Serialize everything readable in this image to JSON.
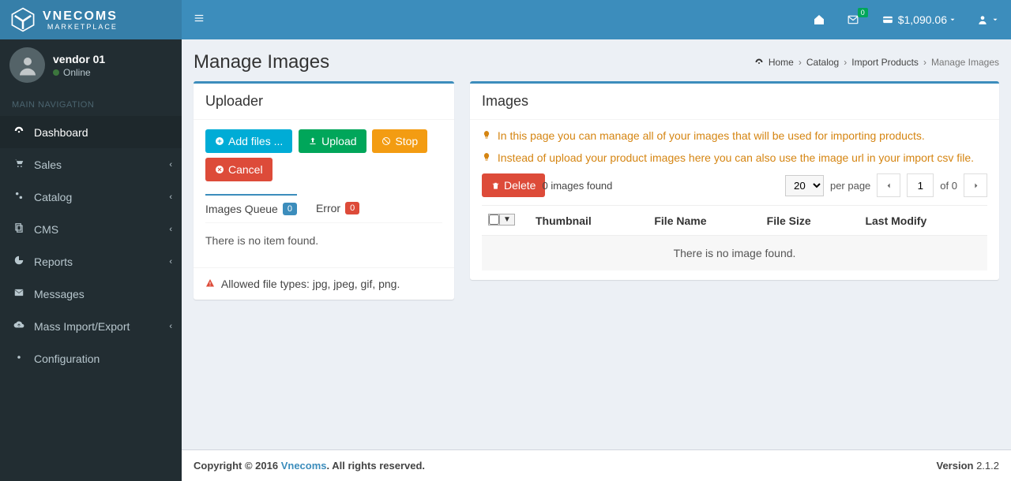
{
  "brand": {
    "name": "VNECOMS",
    "sub": "MARKETPLACE"
  },
  "user": {
    "name": "vendor 01",
    "status": "Online"
  },
  "nav_header": "MAIN NAVIGATION",
  "nav": {
    "dashboard": "Dashboard",
    "sales": "Sales",
    "catalog": "Catalog",
    "cms": "CMS",
    "reports": "Reports",
    "messages": "Messages",
    "massio": "Mass Import/Export",
    "config": "Configuration"
  },
  "topbar": {
    "mail_badge": "0",
    "balance": "$1,090.06"
  },
  "breadcrumb": {
    "home": "Home",
    "catalog": "Catalog",
    "import": "Import Products",
    "current": "Manage Images"
  },
  "page_title": "Manage Images",
  "uploader": {
    "title": "Uploader",
    "add": "Add files ...",
    "upload": "Upload",
    "stop": "Stop",
    "cancel": "Cancel",
    "tab_queue": "Images Queue",
    "tab_queue_count": "0",
    "tab_error": "Error",
    "tab_error_count": "0",
    "empty": "There is no item found.",
    "allowed": "Allowed file types: jpg, jpeg, gif, png."
  },
  "images": {
    "title": "Images",
    "tip1": "In this page you can manage all of your images that will be used for importing products.",
    "tip2": "Instead of upload your product images here you can also use the image url in your import csv file.",
    "delete": "Delete",
    "found_count": "0",
    "found_label": "images found",
    "perpage_value": "20",
    "perpage_label": "per page",
    "page_current": "1",
    "page_total": "0",
    "page_of": "of",
    "th_thumb": "Thumbnail",
    "th_file": "File Name",
    "th_size": "File Size",
    "th_mod": "Last Modify",
    "empty": "There is no image found."
  },
  "footer": {
    "copy_pre": "Copyright © 2016 ",
    "copy_link": "Vnecoms",
    "copy_post": ". All rights reserved.",
    "version_label": "Version",
    "version": "2.1.2"
  }
}
